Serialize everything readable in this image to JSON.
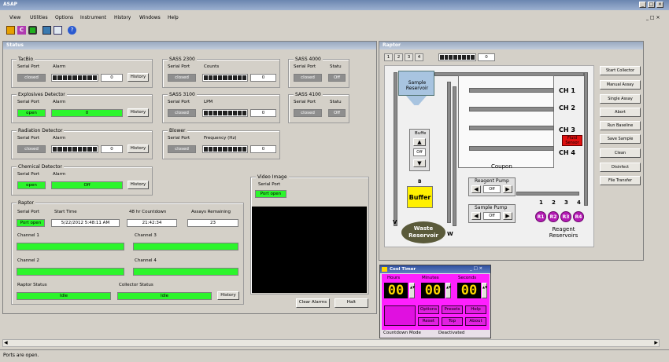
{
  "app": {
    "title": "ASAP"
  },
  "menu": [
    "View",
    "Utilities",
    "Options",
    "Instrument",
    "History",
    "Windows",
    "Help"
  ],
  "status_window": {
    "title": "Status"
  },
  "tacbio": {
    "label": "TacBio",
    "serial_label": "Serial Port",
    "serial_value": "closed",
    "alarm_label": "Alarm",
    "alarm_value": "0",
    "history": "History"
  },
  "explosives": {
    "label": "Explosives Detector",
    "serial_label": "Serial Port",
    "serial_value": "open",
    "alarm_label": "Alarm",
    "alarm_value": "0",
    "history": "History"
  },
  "radiation": {
    "label": "Radiation Detector",
    "serial_label": "Serial Port",
    "serial_value": "closed",
    "alarm_label": "Alarm",
    "alarm_value": "0",
    "history": "History"
  },
  "chemical": {
    "label": "Chemical Detector",
    "serial_label": "Serial Port",
    "serial_value": "open",
    "alarm_label": "Alarm",
    "alarm_value": "Off",
    "history": "History"
  },
  "sass2300": {
    "label": "SASS 2300",
    "serial_label": "Serial Port",
    "serial_value": "closed",
    "counts_label": "Counts",
    "counts_value": "0"
  },
  "sass3100": {
    "label": "SASS 3100",
    "serial_label": "Serial Port",
    "serial_value": "closed",
    "lpm_label": "LPM",
    "lpm_value": "0"
  },
  "blower": {
    "label": "Blower",
    "serial_label": "Serial Port",
    "serial_value": "closed",
    "freq_label": "Frequency (Hz)",
    "freq_value": "0"
  },
  "sass4000": {
    "label": "SASS 4000",
    "serial_label": "Serial Port",
    "serial_value": "closed",
    "status_label": "Statu",
    "status_value": "Off"
  },
  "sass4100": {
    "label": "SASS 4100",
    "serial_label": "Serial Port",
    "serial_value": "closed",
    "status_label": "Statu",
    "status_value": "Off"
  },
  "video": {
    "label": "Video Image",
    "serial_label": "Serial Port",
    "serial_value": "Port open"
  },
  "raptor_group": {
    "label": "Raptor",
    "serial_label": "Serial Port",
    "serial_value": "Port open",
    "start_label": "Start Time",
    "start_value": "5/22/2012 5:48:11 AM",
    "countdown_label": "48 hr Countdown",
    "countdown_value": "21:42:34",
    "assays_label": "Assays Remaining",
    "assays_value": "23",
    "ch1": "Channel 1",
    "ch2": "Channel 2",
    "ch3": "Channel 3",
    "ch4": "Channel 4",
    "raptor_status_label": "Raptor Status",
    "raptor_status_value": "Idle",
    "collector_status_label": "Collector Status",
    "collector_status_value": "Idle",
    "history": "History"
  },
  "buttons": {
    "clear_alarms": "Clear Alarms",
    "halt": "Halt"
  },
  "raptor_window": {
    "title": "Raptor",
    "tabs": [
      "1",
      "2",
      "3",
      "4"
    ],
    "counter": "0"
  },
  "side_buttons": [
    "Start Collector",
    "Manual Assay",
    "Single Assay",
    "Abort",
    "Run Baseline",
    "Save Sample",
    "Clean",
    "Disinfect",
    "File Transfer"
  ],
  "diagram": {
    "sample_reservoir": "Sample Reservoir",
    "buffer_pump": "Buffe",
    "buffer_pump_state": "Off",
    "buffer_line": "B",
    "buffer": "Buffer",
    "waste": "Waste Reservoir",
    "v": "V",
    "w": "W",
    "ch1": "CH 1",
    "ch2": "CH 2",
    "ch3": "CH 3",
    "ch4": "CH 4",
    "fluid_sensor": "Fluid Sensor",
    "coupon": "Coupon",
    "reagent_pump": "Reagent Pump",
    "reagent_state": "Off",
    "sample_pump": "Sample Pump",
    "sample_state": "Off",
    "reagent_nums": [
      "1",
      "2",
      "3",
      "4"
    ],
    "reagents": [
      "R1",
      "R2",
      "R3",
      "R4"
    ],
    "reagent_label": "Reagent Reservoirs"
  },
  "timer": {
    "title": "Cool Timer",
    "hours_label": "Hours",
    "minutes_label": "Minutes",
    "seconds_label": "Seconds",
    "hours": "00",
    "minutes": "00",
    "seconds": "00",
    "buttons": [
      "Options",
      "Presets",
      "Help",
      "Reset",
      "Top",
      "About"
    ],
    "mode": "Countdown Mode",
    "state": "Deactivated"
  },
  "statusbar": {
    "text": "Ports are open."
  },
  "colors": {
    "green": "#2cf52c",
    "magenta": "#ff20ff",
    "red": "#e01010",
    "yellow": "#fff000",
    "purple": "#b41ab4"
  }
}
